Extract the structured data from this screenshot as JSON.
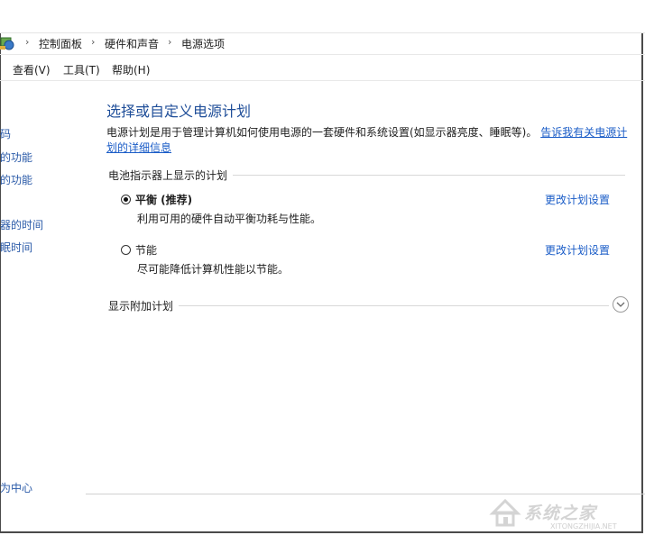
{
  "breadcrumb": {
    "items": [
      "控制面板",
      "硬件和声音",
      "电源选项"
    ],
    "separator": "›"
  },
  "menubar": {
    "view": "查看(V)",
    "tools": "工具(T)",
    "help": "帮助(H)"
  },
  "sidebar": {
    "items": [
      "码",
      "的功能",
      "的功能",
      "器的时间",
      "眠时间"
    ],
    "footer": "为中心"
  },
  "main": {
    "title": "选择或自定义电源计划",
    "description": "电源计划是用于管理计算机如何使用电源的一套硬件和系统设置(如显示器亮度、睡眠等)。",
    "description_link": "告诉我有关电源计划的详细信息",
    "section_header": "电池指示器上显示的计划",
    "plans": [
      {
        "name": "平衡 (推荐)",
        "description": "利用可用的硬件自动平衡功耗与性能。",
        "selected": true,
        "change_label": "更改计划设置"
      },
      {
        "name": "节能",
        "description": "尽可能降低计算机性能以节能。",
        "selected": false,
        "change_label": "更改计划设置"
      }
    ],
    "more_plans_label": "显示附加计划"
  },
  "watermark": {
    "text": "系统之家",
    "url": "XITONGZHIJIA.NET"
  },
  "colors": {
    "title_blue": "#1f4e99",
    "link_blue": "#1a5cc7"
  }
}
